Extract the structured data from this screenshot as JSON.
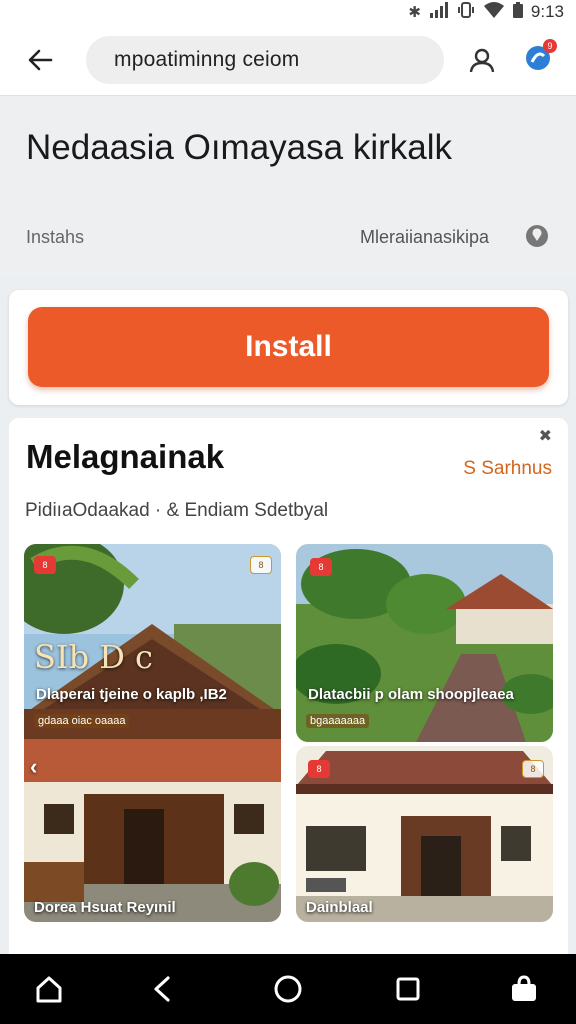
{
  "status_bar": {
    "time": "9:13",
    "icons": [
      "bluetooth-icon",
      "signal-icon",
      "vibrate-icon",
      "wifi-icon",
      "battery-icon"
    ]
  },
  "app_bar": {
    "url": "mpoatiminng ceiom",
    "notification_count": "9",
    "icons": [
      "arrow-back-icon",
      "account-icon",
      "notification-icon"
    ]
  },
  "header": {
    "title": "Nedaasia Oımayasa kirkalk",
    "subtitle_left": "Instahs",
    "subtitle_right": "Mleraiianasikipa",
    "pin_icon": "location-pin-icon"
  },
  "install": {
    "label": "Install",
    "color": "#ed5a2a"
  },
  "section": {
    "close_glyph": "✖",
    "title": "Melagnainak",
    "link": "S Sarhnus",
    "meta": "PidiıaOdaakad · & Endiam Sdetbyal"
  },
  "gallery": {
    "large": {
      "big_text": "SIb D c",
      "caption": "Dlaperai tjeine o kaplb ,IB2",
      "tag": "gdaaa oiac oaaaa",
      "label": "Dorea Hsuat Reyınil",
      "badge": "8"
    },
    "top": {
      "caption": "Dlatacbii p olam shoopjleaea",
      "tag": "bgaaaaaaa",
      "badge": "8"
    },
    "bottom": {
      "label": "Dainblaal",
      "badge": "8"
    }
  },
  "nav": {
    "icons": [
      "home-icon",
      "back-icon",
      "circle-home-icon",
      "recents-icon",
      "bag-icon"
    ]
  },
  "colors": {
    "accent": "#ed5a2a",
    "link": "#d4651e",
    "nav_background": "#000000"
  }
}
